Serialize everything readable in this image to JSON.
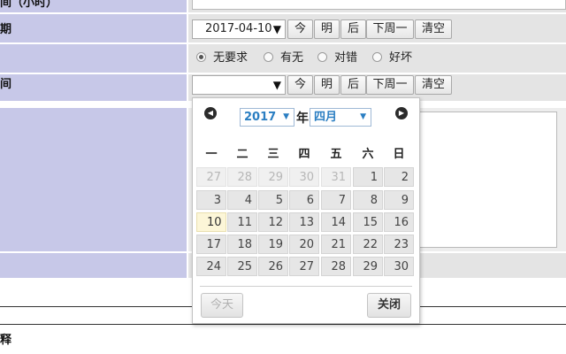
{
  "form": {
    "row1_label": "间（小时）",
    "row2_label": "期",
    "row4_label": "间",
    "bottom_label": "释"
  },
  "date_field_1": {
    "value": "2017-04-10",
    "arrow": "▼"
  },
  "date_field_2": {
    "value": "",
    "arrow": "▼"
  },
  "quick_buttons": {
    "today": "今",
    "tomorrow": "明",
    "after": "后",
    "next_monday": "下周一",
    "clear": "清空"
  },
  "radio_options": [
    {
      "label": "无要求",
      "checked": true
    },
    {
      "label": "有无",
      "checked": false
    },
    {
      "label": "对错",
      "checked": false
    },
    {
      "label": "好坏",
      "checked": false
    }
  ],
  "calendar": {
    "year": "2017",
    "year_suffix": "年",
    "month": "四月",
    "weekdays": [
      "一",
      "二",
      "三",
      "四",
      "五",
      "六",
      "日"
    ],
    "weeks": [
      [
        {
          "d": "27",
          "o": true
        },
        {
          "d": "28",
          "o": true
        },
        {
          "d": "29",
          "o": true
        },
        {
          "d": "30",
          "o": true
        },
        {
          "d": "31",
          "o": true
        },
        {
          "d": "1"
        },
        {
          "d": "2"
        }
      ],
      [
        {
          "d": "3"
        },
        {
          "d": "4"
        },
        {
          "d": "5"
        },
        {
          "d": "6"
        },
        {
          "d": "7"
        },
        {
          "d": "8"
        },
        {
          "d": "9"
        }
      ],
      [
        {
          "d": "10",
          "t": true
        },
        {
          "d": "11"
        },
        {
          "d": "12"
        },
        {
          "d": "13"
        },
        {
          "d": "14"
        },
        {
          "d": "15"
        },
        {
          "d": "16"
        }
      ],
      [
        {
          "d": "17"
        },
        {
          "d": "18"
        },
        {
          "d": "19"
        },
        {
          "d": "20"
        },
        {
          "d": "21"
        },
        {
          "d": "22"
        },
        {
          "d": "23"
        }
      ],
      [
        {
          "d": "24"
        },
        {
          "d": "25"
        },
        {
          "d": "26"
        },
        {
          "d": "27"
        },
        {
          "d": "28"
        },
        {
          "d": "29"
        },
        {
          "d": "30"
        }
      ]
    ],
    "today_button": "今天",
    "close_button": "关闭",
    "prev_icon": "◀",
    "next_icon": "▶",
    "dropdown_icon": "▼"
  },
  "colors": {
    "label_bg": "#c7c8e8",
    "field_bg": "#e4e4e4",
    "accent": "#2a7ec2",
    "today_bg": "#fcf6d8"
  }
}
